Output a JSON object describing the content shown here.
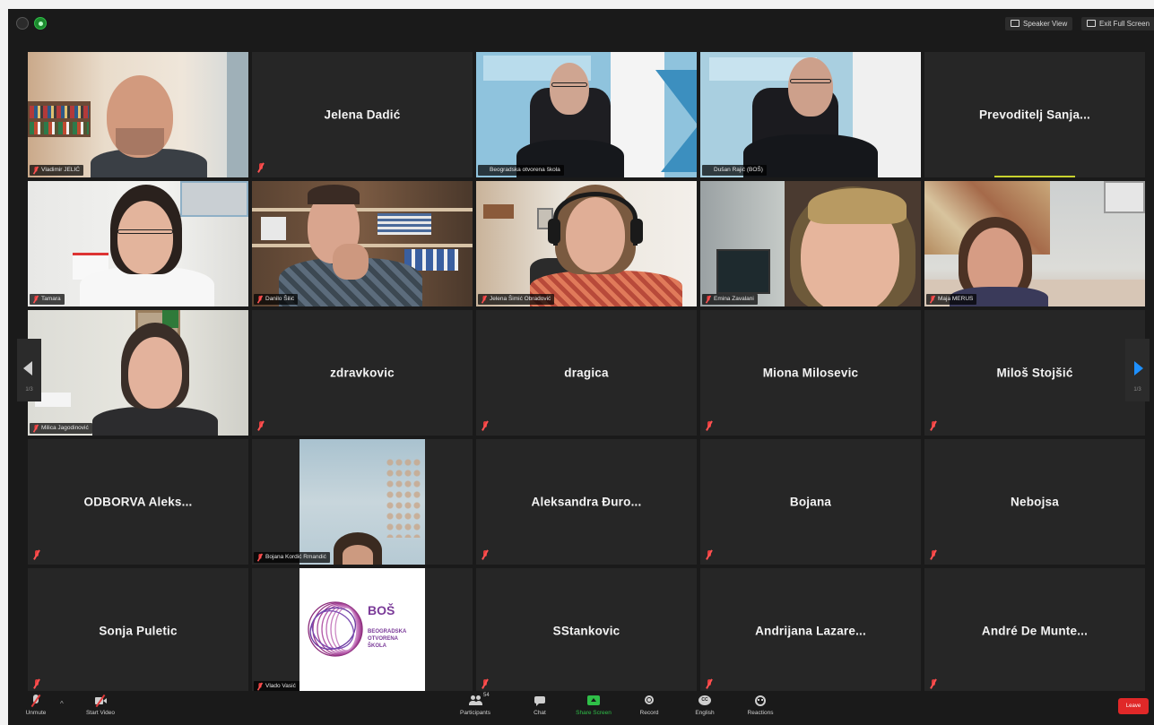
{
  "topbar": {
    "speaker_view_label": "Speaker View",
    "full_screen_label": "Exit Full Screen"
  },
  "participants": [
    {
      "name": "Vladimir JELIĆ",
      "video": true,
      "scene": "man-office"
    },
    {
      "name": "Jelena Dadić",
      "video": false
    },
    {
      "name": "Beogradska otvorena škola",
      "video": true,
      "scene": "man-window"
    },
    {
      "name": "Dušan Rajić (BOŠ)",
      "video": true,
      "scene": "man-window-2",
      "speaking": true
    },
    {
      "name": "Prevoditelj Sanja...",
      "video": false,
      "green_bar": true
    },
    {
      "name": "Tamara",
      "video": true,
      "scene": "woman-glasses"
    },
    {
      "name": "Danilo Šilić",
      "video": true,
      "scene": "man-shelf"
    },
    {
      "name": "Jelena Šimić Obradović",
      "video": true,
      "scene": "woman-headphones"
    },
    {
      "name": "Emina Zavalani",
      "video": true,
      "scene": "woman-closeup"
    },
    {
      "name": "Maja MERUS",
      "video": true,
      "scene": "woman-wall"
    },
    {
      "name": "Milica Jagodinović",
      "video": true,
      "scene": "woman-room"
    },
    {
      "name": "zdravkovic",
      "video": false
    },
    {
      "name": "dragica",
      "video": false
    },
    {
      "name": "Miona Milosevic",
      "video": false
    },
    {
      "name": "Miloš Stojšić",
      "video": false
    },
    {
      "name": "ODBORVA Aleks...",
      "video": false
    },
    {
      "name": "Bojana Kordić Rmandić",
      "video": true,
      "scene": "sky"
    },
    {
      "name": "Aleksandra Đuro...",
      "video": false
    },
    {
      "name": "Bojana",
      "video": false
    },
    {
      "name": "Nebojsa",
      "video": false
    },
    {
      "name": "Sonja Puletic",
      "video": false
    },
    {
      "name": "Vlado Vasić",
      "video": true,
      "scene": "logo"
    },
    {
      "name": "SStankovic",
      "video": false
    },
    {
      "name": "Andrijana Lazare...",
      "video": false
    },
    {
      "name": "André De Munte...",
      "video": false
    }
  ],
  "logo": {
    "line1": "BOŠ",
    "line2": "BEOGRADSKA",
    "line3": "OTVORENA",
    "line4": "ŠKOLA"
  },
  "pager": {
    "left": "1/3",
    "right": "1/3"
  },
  "toolbar": {
    "unmute": "Unmute",
    "start_video": "Start Video",
    "participants": "Participants",
    "participants_count": "54",
    "chat": "Chat",
    "share_screen": "Share Screen",
    "record": "Record",
    "reactions": "Reactions",
    "end": "Leave",
    "cc": "CC",
    "subtitles": "English"
  },
  "colors": {
    "background": "#1a1a1a",
    "tile": "#262626",
    "speaking": "#c8d22e",
    "share_green": "#2fbf48",
    "end_red": "#e02828",
    "muted_red": "#e23b3b",
    "pager_blue": "#1e90ff"
  }
}
